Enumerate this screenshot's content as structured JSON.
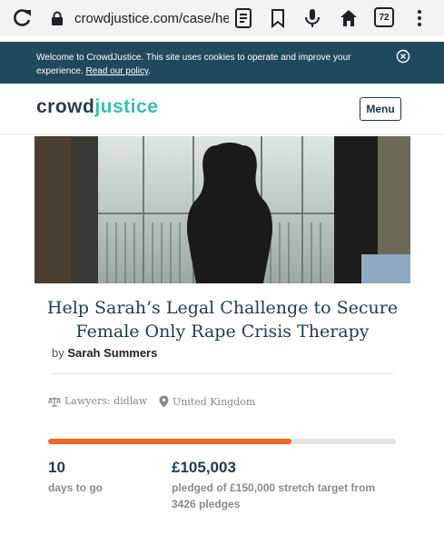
{
  "browser": {
    "url": "crowdjustice.com/case/help",
    "tab_count": "72"
  },
  "cookie_banner": {
    "text": "Welcome to CrowdJustice. This site uses cookies to operate and improve your experience.",
    "link_label": "Read our policy"
  },
  "header": {
    "logo_part1": "crowd",
    "logo_part2": "justice",
    "menu_label": "Menu"
  },
  "campaign": {
    "title": "Help Sarah’s Legal Challenge to Secure Female Only Rape Crisis Therapy",
    "by_label": "by",
    "author": "Sarah Summers",
    "lawyers": "Lawyers: didlaw",
    "location": "United Kingdom",
    "days_value": "10",
    "days_label": "days to go",
    "amount": "£105,003",
    "pledged_text": "pledged of £150,000 stretch target from 3426 pledges",
    "progress_fraction": 0.7
  },
  "colors": {
    "banner": "#1f4a5e",
    "accent": "#38bfa7",
    "progress": "#ef6a1c",
    "title": "#1e3c4d"
  }
}
